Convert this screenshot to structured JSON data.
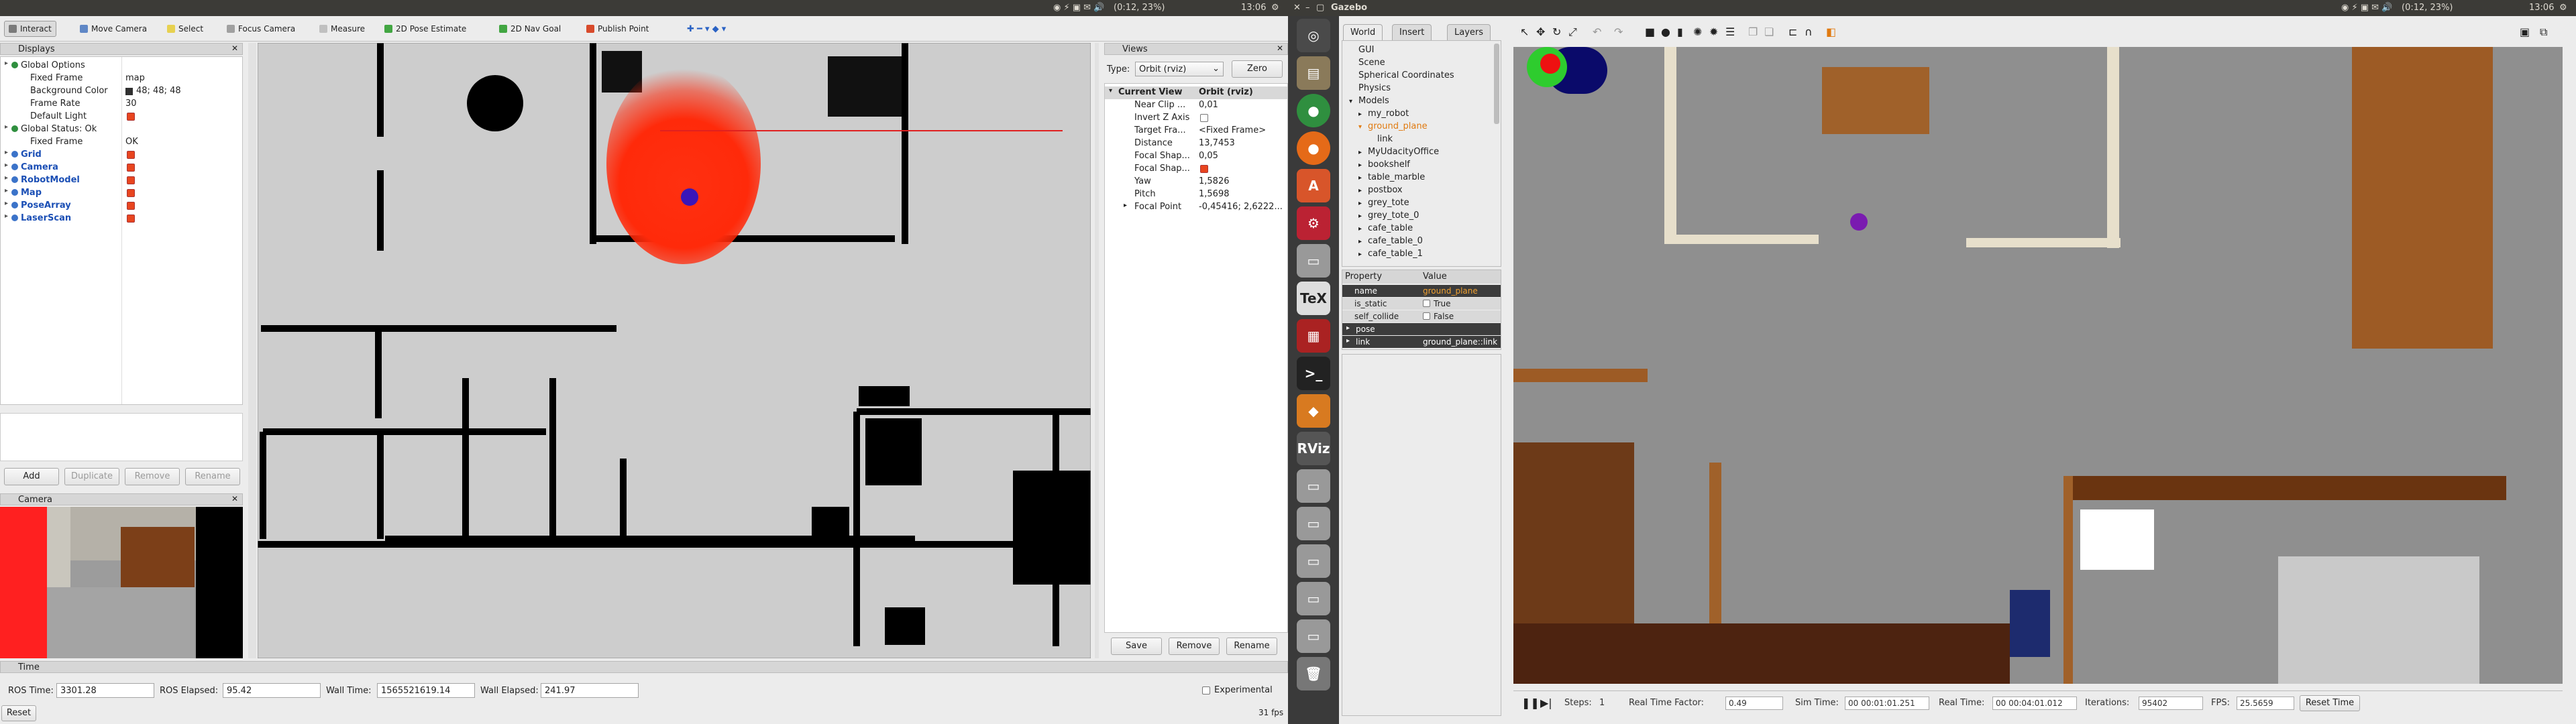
{
  "rviz": {
    "topbar": {
      "clock": "13:06",
      "battery": "(0:12, 23%)"
    },
    "toolbar": [
      {
        "label": "Interact",
        "color": "#7a7a7a",
        "active": true
      },
      {
        "label": "Move Camera",
        "color": "#5f87c6"
      },
      {
        "label": "Select",
        "color": "#e7d150"
      },
      {
        "label": "Focus Camera",
        "color": "#a0a0a0"
      },
      {
        "label": "Measure",
        "color": "#c0c0c0"
      },
      {
        "label": "2D Pose Estimate",
        "color": "#42a642"
      },
      {
        "label": "2D Nav Goal",
        "color": "#42a642"
      },
      {
        "label": "Publish Point",
        "color": "#d84a2b"
      }
    ],
    "displays": {
      "title": "Displays",
      "rows": [
        {
          "label": "Global Options",
          "indent": 1,
          "value": ""
        },
        {
          "label": "Fixed Frame",
          "indent": 2,
          "value": "map"
        },
        {
          "label": "Background Color",
          "indent": 2,
          "value": "48; 48; 48"
        },
        {
          "label": "Frame Rate",
          "indent": 2,
          "value": "30"
        },
        {
          "label": "Default Light",
          "indent": 2,
          "value": ""
        },
        {
          "label": "Global Status: Ok",
          "indent": 1,
          "value": ""
        },
        {
          "label": "Fixed Frame",
          "indent": 2,
          "value": "OK"
        },
        {
          "label": "Grid",
          "indent": 1,
          "value": "",
          "blue": true
        },
        {
          "label": "Camera",
          "indent": 1,
          "value": "",
          "blue": true
        },
        {
          "label": "RobotModel",
          "indent": 1,
          "value": "",
          "blue": true
        },
        {
          "label": "Map",
          "indent": 1,
          "value": "",
          "blue": true
        },
        {
          "label": "PoseArray",
          "indent": 1,
          "value": "",
          "blue": true
        },
        {
          "label": "LaserScan",
          "indent": 1,
          "value": "",
          "blue": true
        }
      ],
      "buttons": [
        "Add",
        "Duplicate",
        "Remove",
        "Rename"
      ]
    },
    "camera_panel": {
      "title": "Camera"
    },
    "views": {
      "title": "Views",
      "type_label": "Type:",
      "type_value": "Orbit (rviz)",
      "zero_label": "Zero",
      "rows": [
        {
          "label": "Current View",
          "value": "Orbit (rviz)",
          "header": true
        },
        {
          "label": "Near Clip ...",
          "value": "0,01"
        },
        {
          "label": "Invert Z Axis",
          "value": ""
        },
        {
          "label": "Target Fra...",
          "value": "<Fixed Frame>"
        },
        {
          "label": "Distance",
          "value": "13,7453"
        },
        {
          "label": "Focal Shap...",
          "value": "0,05"
        },
        {
          "label": "Focal Shap...",
          "value": ""
        },
        {
          "label": "Yaw",
          "value": "1,5826"
        },
        {
          "label": "Pitch",
          "value": "1,5698"
        },
        {
          "label": "Focal Point",
          "value": "-0,45416; 2,6222..."
        }
      ],
      "buttons": [
        "Save",
        "Remove",
        "Rename"
      ]
    },
    "time": {
      "title": "Time",
      "ros_time_label": "ROS Time:",
      "ros_time": "3301.28",
      "ros_elapsed_label": "ROS Elapsed:",
      "ros_elapsed": "95.42",
      "wall_time_label": "Wall Time:",
      "wall_time": "1565521619.14",
      "wall_elapsed_label": "Wall Elapsed:",
      "wall_elapsed": "241.97",
      "experimental": "Experimental",
      "reset": "Reset",
      "fps": "31 fps"
    }
  },
  "gazebo": {
    "app_title": "Gazebo",
    "topbar": {
      "clock": "13:06",
      "battery": "(0:12, 23%)"
    },
    "tabs": [
      "World",
      "Insert",
      "Layers"
    ],
    "world_tree": [
      {
        "label": "GUI",
        "indent": 0
      },
      {
        "label": "Scene",
        "indent": 0
      },
      {
        "label": "Spherical Coordinates",
        "indent": 0
      },
      {
        "label": "Physics",
        "indent": 0
      },
      {
        "label": "Models",
        "indent": 0
      },
      {
        "label": "my_robot",
        "indent": 1
      },
      {
        "label": "ground_plane",
        "indent": 1,
        "highlight": true
      },
      {
        "label": "link",
        "indent": 2
      },
      {
        "label": "MyUdacityOffice",
        "indent": 1
      },
      {
        "label": "bookshelf",
        "indent": 1
      },
      {
        "label": "table_marble",
        "indent": 1
      },
      {
        "label": "postbox",
        "indent": 1
      },
      {
        "label": "grey_tote",
        "indent": 1
      },
      {
        "label": "grey_tote_0",
        "indent": 1
      },
      {
        "label": "cafe_table",
        "indent": 1
      },
      {
        "label": "cafe_table_0",
        "indent": 1
      },
      {
        "label": "cafe_table_1",
        "indent": 1
      }
    ],
    "properties": {
      "header_property": "Property",
      "header_value": "Value",
      "rows": [
        {
          "name": "name",
          "value": "ground_plane"
        },
        {
          "name": "is_static",
          "value": "True"
        },
        {
          "name": "self_collide",
          "value": "False"
        },
        {
          "name": "pose",
          "value": ""
        },
        {
          "name": "link",
          "value": "ground_plane::link"
        }
      ]
    },
    "status": {
      "steps_label": "Steps:",
      "steps": "1",
      "rtf_label": "Real Time Factor:",
      "rtf": "0.49",
      "sim_time_label": "Sim Time:",
      "sim_time": "00 00:01:01.251",
      "real_time_label": "Real Time:",
      "real_time": "00 00:04:01.012",
      "iterations_label": "Iterations:",
      "iterations": "95402",
      "fps_label": "FPS:",
      "fps": "25.5659",
      "reset_label": "Reset Time"
    }
  }
}
